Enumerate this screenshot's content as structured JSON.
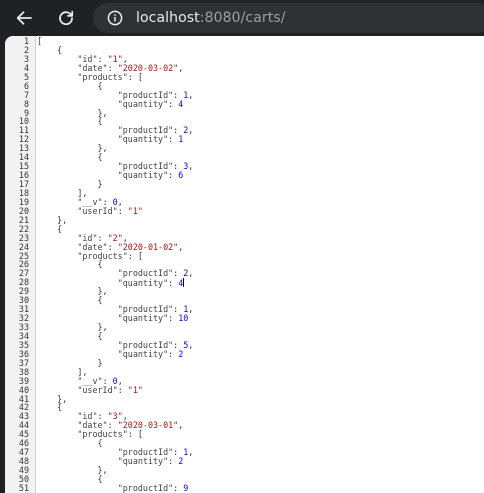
{
  "browser": {
    "url_host": "localhost",
    "url_rest": ":8080/carts/",
    "back_icon": "arrow-left-icon",
    "reload_icon": "reload-icon",
    "info_icon": "info-circle-icon"
  },
  "json_view": {
    "lines": [
      [
        [
          "p",
          "["
        ]
      ],
      [
        [
          "p",
          "    {"
        ]
      ],
      [
        [
          "p",
          "        "
        ],
        [
          "k",
          "\"id\""
        ],
        [
          "p",
          ": "
        ],
        [
          "s",
          "\"1\""
        ],
        [
          "p",
          ","
        ]
      ],
      [
        [
          "p",
          "        "
        ],
        [
          "k",
          "\"date\""
        ],
        [
          "p",
          ": "
        ],
        [
          "s",
          "\"2020-03-02\""
        ],
        [
          "p",
          ","
        ]
      ],
      [
        [
          "p",
          "        "
        ],
        [
          "k",
          "\"products\""
        ],
        [
          "p",
          ": ["
        ]
      ],
      [
        [
          "p",
          "            {"
        ]
      ],
      [
        [
          "p",
          "                "
        ],
        [
          "k",
          "\"productId\""
        ],
        [
          "p",
          ": "
        ],
        [
          "n",
          "1"
        ],
        [
          "p",
          ","
        ]
      ],
      [
        [
          "p",
          "                "
        ],
        [
          "k",
          "\"quantity\""
        ],
        [
          "p",
          ": "
        ],
        [
          "n",
          "4"
        ]
      ],
      [
        [
          "p",
          "            },"
        ]
      ],
      [
        [
          "p",
          "            {"
        ]
      ],
      [
        [
          "p",
          "                "
        ],
        [
          "k",
          "\"productId\""
        ],
        [
          "p",
          ": "
        ],
        [
          "n",
          "2"
        ],
        [
          "p",
          ","
        ]
      ],
      [
        [
          "p",
          "                "
        ],
        [
          "k",
          "\"quantity\""
        ],
        [
          "p",
          ": "
        ],
        [
          "n",
          "1"
        ]
      ],
      [
        [
          "p",
          "            },"
        ]
      ],
      [
        [
          "p",
          "            {"
        ]
      ],
      [
        [
          "p",
          "                "
        ],
        [
          "k",
          "\"productId\""
        ],
        [
          "p",
          ": "
        ],
        [
          "n",
          "3"
        ],
        [
          "p",
          ","
        ]
      ],
      [
        [
          "p",
          "                "
        ],
        [
          "k",
          "\"quantity\""
        ],
        [
          "p",
          ": "
        ],
        [
          "n",
          "6"
        ]
      ],
      [
        [
          "p",
          "            }"
        ]
      ],
      [
        [
          "p",
          "        ],"
        ]
      ],
      [
        [
          "p",
          "        "
        ],
        [
          "k",
          "\"__v\""
        ],
        [
          "p",
          ": "
        ],
        [
          "n",
          "0"
        ],
        [
          "p",
          ","
        ]
      ],
      [
        [
          "p",
          "        "
        ],
        [
          "k",
          "\"userId\""
        ],
        [
          "p",
          ": "
        ],
        [
          "s",
          "\"1\""
        ]
      ],
      [
        [
          "p",
          "    },"
        ]
      ],
      [
        [
          "p",
          "    {"
        ]
      ],
      [
        [
          "p",
          "        "
        ],
        [
          "k",
          "\"id\""
        ],
        [
          "p",
          ": "
        ],
        [
          "s",
          "\"2\""
        ],
        [
          "p",
          ","
        ]
      ],
      [
        [
          "p",
          "        "
        ],
        [
          "k",
          "\"date\""
        ],
        [
          "p",
          ": "
        ],
        [
          "s",
          "\"2020-01-02\""
        ],
        [
          "p",
          ","
        ]
      ],
      [
        [
          "p",
          "        "
        ],
        [
          "k",
          "\"products\""
        ],
        [
          "p",
          ": ["
        ]
      ],
      [
        [
          "p",
          "            {"
        ]
      ],
      [
        [
          "p",
          "                "
        ],
        [
          "k",
          "\"productId\""
        ],
        [
          "p",
          ": "
        ],
        [
          "n",
          "2"
        ],
        [
          "p",
          ","
        ]
      ],
      [
        [
          "p",
          "                "
        ],
        [
          "k",
          "\"quantity\""
        ],
        [
          "p",
          ": "
        ],
        [
          "n",
          "4"
        ]
      ],
      [
        [
          "p",
          "            },"
        ]
      ],
      [
        [
          "p",
          "            {"
        ]
      ],
      [
        [
          "p",
          "                "
        ],
        [
          "k",
          "\"productId\""
        ],
        [
          "p",
          ": "
        ],
        [
          "n",
          "1"
        ],
        [
          "p",
          ","
        ]
      ],
      [
        [
          "p",
          "                "
        ],
        [
          "k",
          "\"quantity\""
        ],
        [
          "p",
          ": "
        ],
        [
          "n",
          "10"
        ]
      ],
      [
        [
          "p",
          "            },"
        ]
      ],
      [
        [
          "p",
          "            {"
        ]
      ],
      [
        [
          "p",
          "                "
        ],
        [
          "k",
          "\"productId\""
        ],
        [
          "p",
          ": "
        ],
        [
          "n",
          "5"
        ],
        [
          "p",
          ","
        ]
      ],
      [
        [
          "p",
          "                "
        ],
        [
          "k",
          "\"quantity\""
        ],
        [
          "p",
          ": "
        ],
        [
          "n",
          "2"
        ]
      ],
      [
        [
          "p",
          "            }"
        ]
      ],
      [
        [
          "p",
          "        ],"
        ]
      ],
      [
        [
          "p",
          "        "
        ],
        [
          "k",
          "\"__v\""
        ],
        [
          "p",
          ": "
        ],
        [
          "n",
          "0"
        ],
        [
          "p",
          ","
        ]
      ],
      [
        [
          "p",
          "        "
        ],
        [
          "k",
          "\"userId\""
        ],
        [
          "p",
          ": "
        ],
        [
          "s",
          "\"1\""
        ]
      ],
      [
        [
          "p",
          "    },"
        ]
      ],
      [
        [
          "p",
          "    {"
        ]
      ],
      [
        [
          "p",
          "        "
        ],
        [
          "k",
          "\"id\""
        ],
        [
          "p",
          ": "
        ],
        [
          "s",
          "\"3\""
        ],
        [
          "p",
          ","
        ]
      ],
      [
        [
          "p",
          "        "
        ],
        [
          "k",
          "\"date\""
        ],
        [
          "p",
          ": "
        ],
        [
          "s",
          "\"2020-03-01\""
        ],
        [
          "p",
          ","
        ]
      ],
      [
        [
          "p",
          "        "
        ],
        [
          "k",
          "\"products\""
        ],
        [
          "p",
          ": ["
        ]
      ],
      [
        [
          "p",
          "            {"
        ]
      ],
      [
        [
          "p",
          "                "
        ],
        [
          "k",
          "\"productId\""
        ],
        [
          "p",
          ": "
        ],
        [
          "n",
          "1"
        ],
        [
          "p",
          ","
        ]
      ],
      [
        [
          "p",
          "                "
        ],
        [
          "k",
          "\"quantity\""
        ],
        [
          "p",
          ": "
        ],
        [
          "n",
          "2"
        ]
      ],
      [
        [
          "p",
          "            },"
        ]
      ],
      [
        [
          "p",
          "            {"
        ]
      ],
      [
        [
          "p",
          "                "
        ],
        [
          "k",
          "\"productId\""
        ],
        [
          "p",
          ": "
        ],
        [
          "n",
          "9"
        ]
      ]
    ],
    "caret_line": 28
  }
}
